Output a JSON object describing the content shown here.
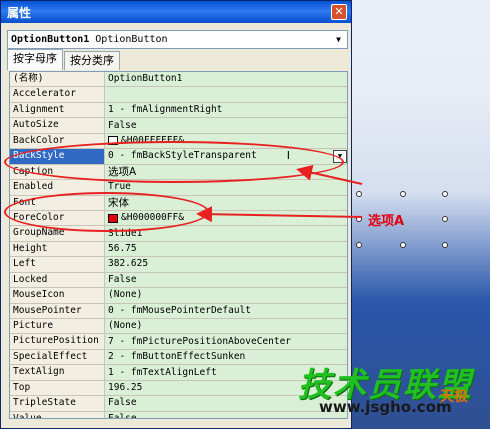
{
  "window": {
    "title": "属性",
    "close_glyph": "✕"
  },
  "object_select": {
    "name": "OptionButton1",
    "type": "OptionButton"
  },
  "tabs": [
    {
      "label": "按字母序",
      "active": true
    },
    {
      "label": "按分类序",
      "active": false
    }
  ],
  "properties": [
    {
      "name": "(名称)",
      "value": "OptionButton1"
    },
    {
      "name": "Accelerator",
      "value": ""
    },
    {
      "name": "Alignment",
      "value": "1 - fmAlignmentRight"
    },
    {
      "name": "AutoSize",
      "value": "False"
    },
    {
      "name": "BackColor",
      "value": "&H00FFFFFF&",
      "swatch": "#ffffff"
    },
    {
      "name": "BackStyle",
      "value": "0 - fmBackStyleTransparent",
      "selected": true
    },
    {
      "name": "Caption",
      "value": "选项A"
    },
    {
      "name": "Enabled",
      "value": "True"
    },
    {
      "name": "Font",
      "value": "宋体"
    },
    {
      "name": "ForeColor",
      "value": "&H000000FF&",
      "swatch": "#e00000"
    },
    {
      "name": "GroupName",
      "value": "Slide1"
    },
    {
      "name": "Height",
      "value": "56.75"
    },
    {
      "name": "Left",
      "value": "382.625"
    },
    {
      "name": "Locked",
      "value": "False"
    },
    {
      "name": "MouseIcon",
      "value": "(None)"
    },
    {
      "name": "MousePointer",
      "value": "0 - fmMousePointerDefault"
    },
    {
      "name": "Picture",
      "value": "(None)"
    },
    {
      "name": "PicturePosition",
      "value": "7 - fmPicturePositionAboveCenter"
    },
    {
      "name": "SpecialEffect",
      "value": "2 - fmButtonEffectSunken"
    },
    {
      "name": "TextAlign",
      "value": "1 - fmTextAlignLeft"
    },
    {
      "name": "Top",
      "value": "196.25"
    },
    {
      "name": "TripleState",
      "value": "False"
    },
    {
      "name": "Value",
      "value": "False"
    }
  ],
  "slide": {
    "option_label": "选项A"
  },
  "watermark": {
    "text": "技术员联盟",
    "url": "www.jsgho.com",
    "brand": "天极"
  },
  "colors": {
    "annotation": "#e82020",
    "title_bar": "#0a52d6",
    "value_bg": "#d9f0d6"
  }
}
